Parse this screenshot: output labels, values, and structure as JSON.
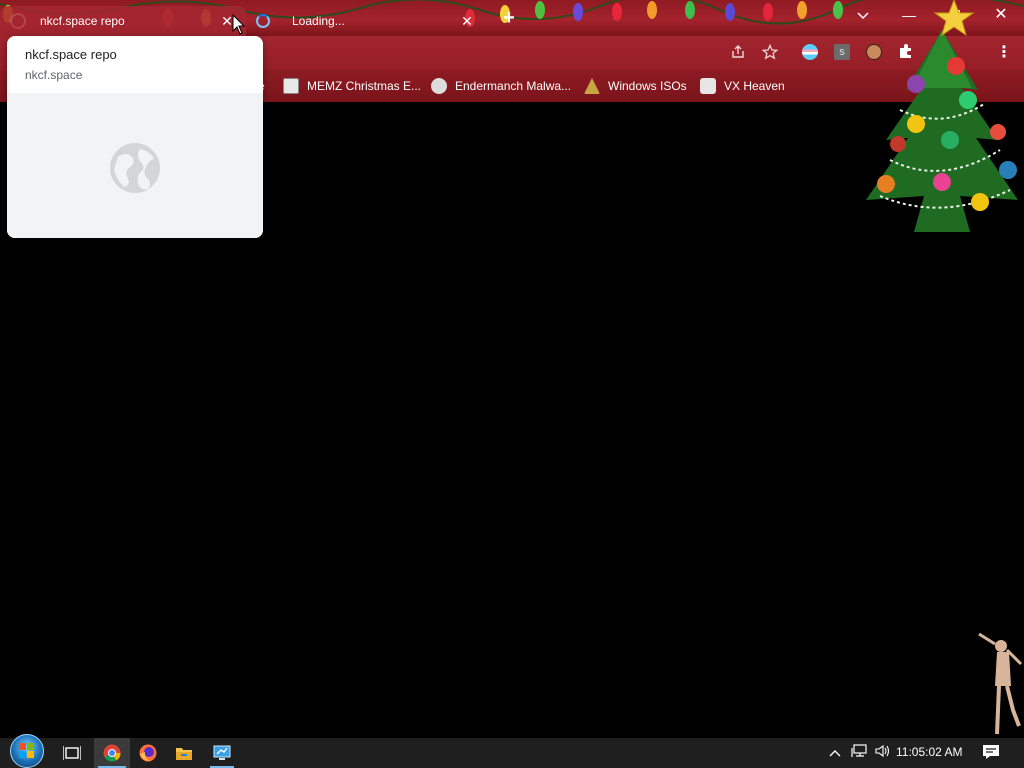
{
  "browser": {
    "tabs": [
      {
        "title": "nkcf.space repo",
        "active": true
      },
      {
        "title": "Loading...",
        "active": false,
        "loading": true
      }
    ],
    "new_tab_symbol": "+",
    "window_controls": {
      "tab_search": "chevron-down-icon",
      "minimize": "—",
      "maximize": "maximize-icon",
      "close": "✕"
    },
    "toolbar_icons": [
      "share-icon",
      "bookmark-star-icon",
      "extension-flag-icon",
      "extension-s-icon",
      "profile-avatar-icon",
      "extensions-puzzle-icon",
      "menu-dots-icon"
    ],
    "extension_s_label": "s",
    "bookmarks": [
      {
        "label": "e",
        "partial": true
      },
      {
        "label": "MEMZ Christmas E..."
      },
      {
        "label": "Endermanch Malwa..."
      },
      {
        "label": "Windows ISOs"
      },
      {
        "label": "VX Heaven"
      }
    ]
  },
  "hover_card": {
    "title": "nkcf.space repo",
    "domain": "nkcf.space",
    "preview_icon": "globe-icon"
  },
  "taskbar": {
    "apps": [
      "start-orb",
      "task-view-icon",
      "chrome-icon",
      "firefox-icon",
      "file-explorer-icon",
      "remote-desktop-icon"
    ],
    "tray": [
      "chevron-up-icon",
      "network-icon",
      "volume-icon"
    ],
    "clock": "11:05:02 AM",
    "notifications_icon": "action-center-icon"
  },
  "colors": {
    "tabstrip": "#a4232c",
    "toolbar": "#9b2129",
    "bookmarks_bar": "#85171f",
    "page_background": "#000000",
    "taskbar": "#1f1f1f"
  }
}
